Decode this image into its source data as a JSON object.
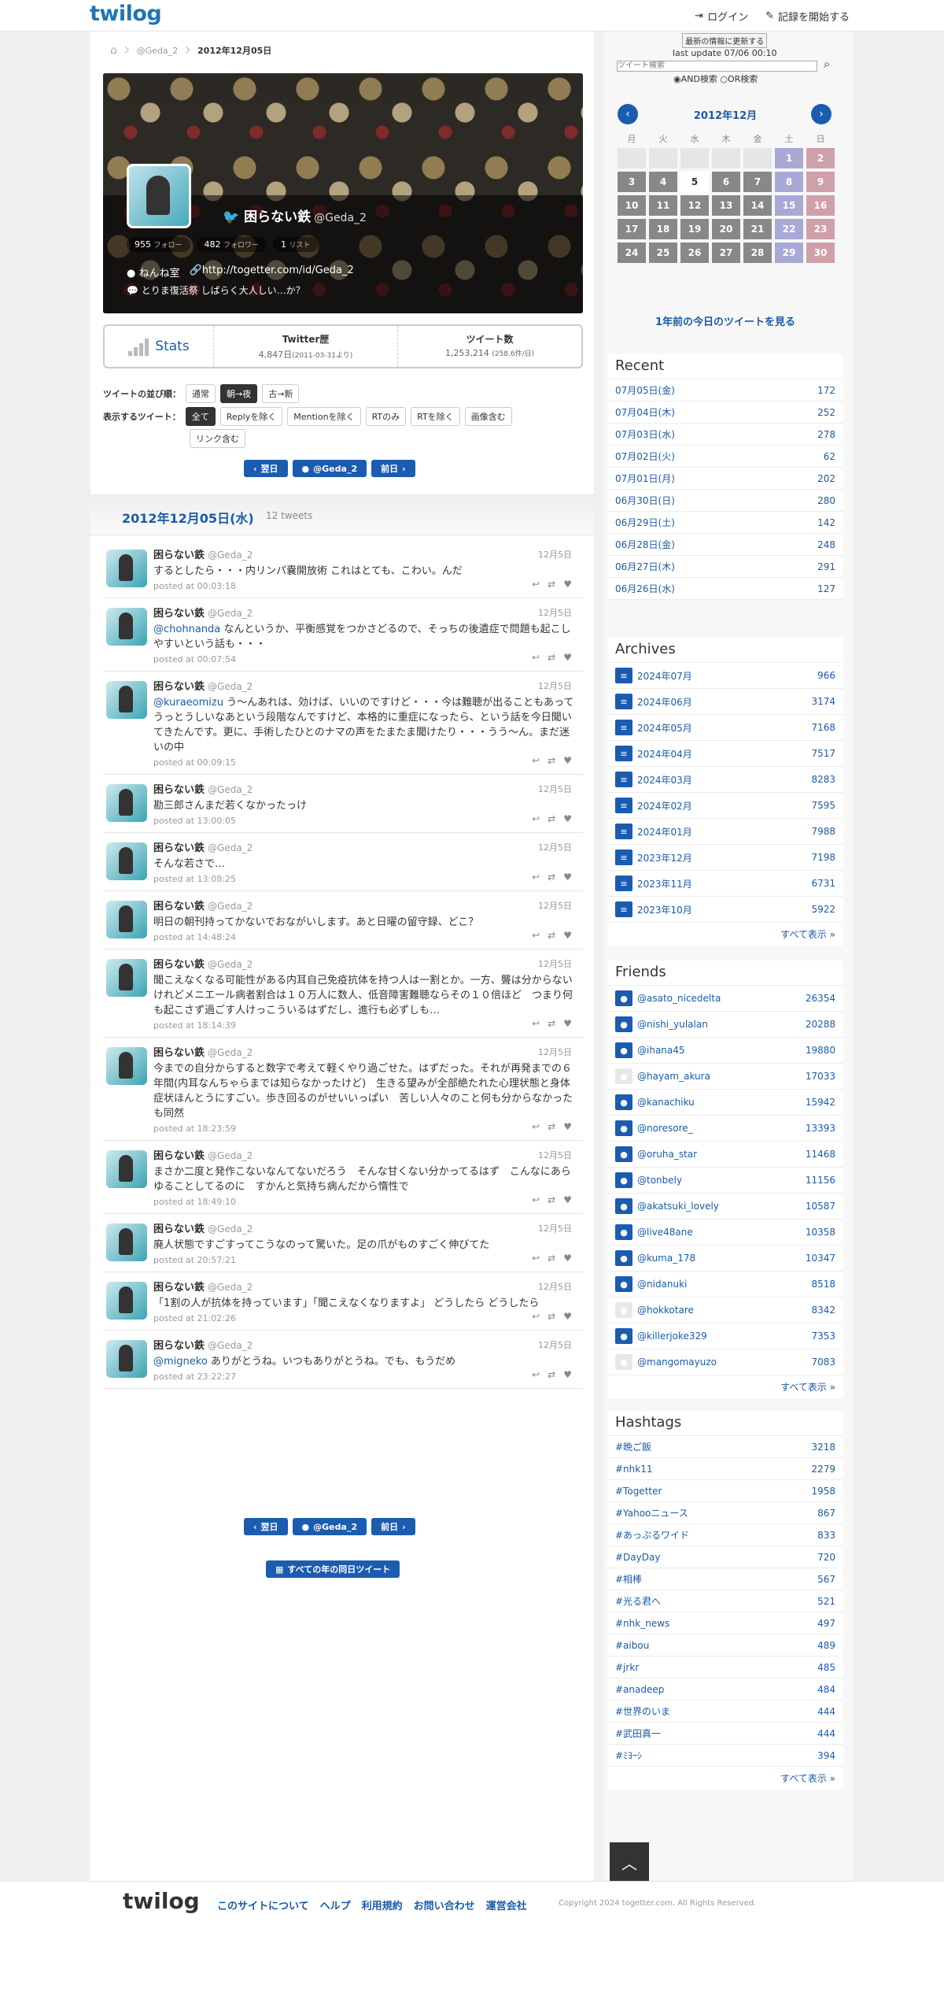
{
  "header": {
    "logo": "twilog",
    "login": "ログイン",
    "start": "記録を開始する"
  },
  "breadcrumb": {
    "user": "@Geda_2",
    "date": "2012年12月05日"
  },
  "profile": {
    "name": "困らない鉄",
    "handle": "@Geda_2",
    "followers": "955",
    "followers_label": "フォロー",
    "following": "482",
    "following_label": "フォロワー",
    "lists": "1",
    "lists_label": "リスト",
    "location": "ねんね室",
    "url": "http://togetter.com/id/Geda_2",
    "bio": "とりま復活祭 しばらく大人しい…か？"
  },
  "stats": {
    "label": "Stats",
    "history_title": "Twitter歴",
    "history_value": "4,847日",
    "history_since": "(2011-03-31より)",
    "count_title": "ツイート数",
    "count_value": "1,253,214",
    "count_avg": "(258.6件/日)"
  },
  "order": {
    "label": "ツイートの並び順：",
    "opts": [
      "通常",
      "朝→夜",
      "古→新"
    ]
  },
  "filter": {
    "label": "表示するツイート：",
    "opts": [
      "全て",
      "Replyを除く",
      "Mentionを除く",
      "RTのみ",
      "RTを除く",
      "画像含む",
      "リンク含む"
    ]
  },
  "nav": {
    "next": "翌日",
    "user": "@Geda_2",
    "prev": "前日"
  },
  "day": {
    "title": "2012年12月05日(水)",
    "count": "12 tweets"
  },
  "tweets": [
    {
      "text": "するとしたら・・・内リンパ嚢開放術 これはとても、こわい。んだ",
      "mention": "",
      "time": "posted at 00:03:18"
    },
    {
      "text": " なんというか、平衡感覚をつかさどるので、そっちの後遺症で問題も起こしやすいという話も・・・",
      "mention": "@chohnanda",
      "time": "posted at 00:07:54"
    },
    {
      "text": " う〜んあれは、効けば、いいのですけど・・・今は難聴が出ることもあってうっとうしいなあという段階なんですけど、本格的に重症になったら、という話を今日聞いてきたんです。更に、手術したひとのナマの声をたまたま聞けたり・・・うう〜ん。まだ迷いの中",
      "mention": "@kuraeomizu",
      "time": "posted at 00:09:15"
    },
    {
      "text": "勘三郎さんまだ若くなかったっけ",
      "mention": "",
      "time": "posted at 13:00:05"
    },
    {
      "text": "そんな若さで…",
      "mention": "",
      "time": "posted at 13:08:25"
    },
    {
      "text": "明日の朝刊持ってかないでおながいします。あと日曜の留守録、どこ？",
      "mention": "",
      "time": "posted at 14:48:24"
    },
    {
      "text": "聞こえなくなる可能性がある内耳自己免疫抗体を持つ人は一割とか。一方、聾は分からないけれどメニエール病者割合は１０万人に数人、低音障害難聴ならその１０倍ほど　つまり何も起こさず過ごす人けっこういるはずだし、進行も必ずしも…",
      "mention": "",
      "time": "posted at 18:14:39"
    },
    {
      "text": "今までの自分からすると数字で考えて軽くやり過ごせた。はずだった。それが再発までの６年間(内耳なんちゃらまでは知らなかったけど)　生きる望みが全部絶たれた心理状態と身体症状ほんとうにすごい。歩き回るのがせいいっぱい　苦しい人々のこと何も分からなかったも同然",
      "mention": "",
      "time": "posted at 18:23:59"
    },
    {
      "text": "まさか二度と発作こないなんてないだろう　そんな甘くない分かってるはず　こんなにあらゆることしてるのに　すかんと気持ち病んだから惰性で",
      "mention": "",
      "time": "posted at 18:49:10"
    },
    {
      "text": "廃人状態ですごすってこうなのって驚いた。足の爪がものすごく伸びてた",
      "mention": "",
      "time": "posted at 20:57:21"
    },
    {
      "text": "「1割の人が抗体を持っています」「聞こえなくなりますよ」 どうしたら どうしたら",
      "mention": "",
      "time": "posted at 21:02:26"
    },
    {
      "text": " ありがとうね。いつもありがとうね。でも、もうだめ",
      "mention": "@migneko",
      "time": "posted at 23:22:27"
    }
  ],
  "tweet_name": "困らない鉄",
  "tweet_handle": "@Geda_2",
  "tweet_date": "12月5日",
  "all_years": "すべての年の同日ツイート",
  "search": {
    "placeholder": "ツイート検索",
    "update_btn": "最新の情報に更新する",
    "last_update": "last update 07/06 00:10",
    "and": "AND検索",
    "or": "OR検索"
  },
  "calendar": {
    "title": "2012年12月",
    "weekdays": [
      "月",
      "火",
      "水",
      "木",
      "金",
      "土",
      "日"
    ],
    "year_ago": "1年前の今日のツイートを見る"
  },
  "recent": {
    "title": "Recent",
    "items": [
      [
        "07月05日(金)",
        "172"
      ],
      [
        "07月04日(木)",
        "252"
      ],
      [
        "07月03日(水)",
        "278"
      ],
      [
        "07月02日(火)",
        "62"
      ],
      [
        "07月01日(月)",
        "202"
      ],
      [
        "06月30日(日)",
        "280"
      ],
      [
        "06月29日(土)",
        "142"
      ],
      [
        "06月28日(金)",
        "248"
      ],
      [
        "06月27日(木)",
        "291"
      ],
      [
        "06月26日(水)",
        "127"
      ]
    ]
  },
  "archives": {
    "title": "Archives",
    "more": "すべて表示 »",
    "items": [
      [
        "2024年07月",
        "966"
      ],
      [
        "2024年06月",
        "3174"
      ],
      [
        "2024年05月",
        "7168"
      ],
      [
        "2024年04月",
        "7517"
      ],
      [
        "2024年03月",
        "8283"
      ],
      [
        "2024年02月",
        "7595"
      ],
      [
        "2024年01月",
        "7988"
      ],
      [
        "2023年12月",
        "7198"
      ],
      [
        "2023年11月",
        "6731"
      ],
      [
        "2023年10月",
        "5922"
      ]
    ]
  },
  "friends": {
    "title": "Friends",
    "more": "すべて表示 »",
    "items": [
      [
        "@asato_nicedelta",
        "26354"
      ],
      [
        "@nishi_yulalan",
        "20288"
      ],
      [
        "@ihana45",
        "19880"
      ],
      [
        "@hayam_akura",
        "17033"
      ],
      [
        "@kanachiku",
        "15942"
      ],
      [
        "@noresore_",
        "13393"
      ],
      [
        "@oruha_star",
        "11468"
      ],
      [
        "@tonbely",
        "11156"
      ],
      [
        "@akatsuki_lovely",
        "10587"
      ],
      [
        "@live48ane",
        "10358"
      ],
      [
        "@kuma_178",
        "10347"
      ],
      [
        "@nidanuki",
        "8518"
      ],
      [
        "@hokkotare",
        "8342"
      ],
      [
        "@killerjoke329",
        "7353"
      ],
      [
        "@mangomayuzo",
        "7083"
      ]
    ]
  },
  "hashtags": {
    "title": "Hashtags",
    "more": "すべて表示 »",
    "items": [
      [
        "#晩ご飯",
        "3218"
      ],
      [
        "#nhk11",
        "2279"
      ],
      [
        "#Togetter",
        "1958"
      ],
      [
        "#Yahooニュース",
        "867"
      ],
      [
        "#あっぷるワイド",
        "833"
      ],
      [
        "#DayDay",
        "720"
      ],
      [
        "#相棒",
        "567"
      ],
      [
        "#光る君へ",
        "521"
      ],
      [
        "#nhk_news",
        "497"
      ],
      [
        "#aibou",
        "489"
      ],
      [
        "#jrkr",
        "485"
      ],
      [
        "#anadeep",
        "484"
      ],
      [
        "#世界のいま",
        "444"
      ],
      [
        "#武田真一",
        "444"
      ],
      [
        "#ﾐﾖｰｼ",
        "394"
      ]
    ]
  },
  "footer": {
    "logo": "twilog",
    "links": [
      "このサイトについて",
      "ヘルプ",
      "利用規約",
      "お問い合わせ",
      "運営会社"
    ],
    "copyright": "Copyright 2024 togetter.com. All Rights Reserved."
  }
}
